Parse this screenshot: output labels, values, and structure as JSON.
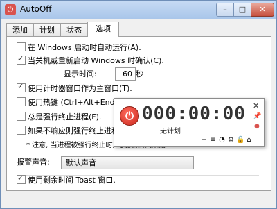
{
  "window": {
    "title": "AutoOff",
    "minimize": "–",
    "maximize": "□",
    "close": "✕"
  },
  "tabs": [
    {
      "label": "添加"
    },
    {
      "label": "计划"
    },
    {
      "label": "状态"
    },
    {
      "label": "选项"
    }
  ],
  "options": {
    "autostart": {
      "label": "在 Windows 启动时自动运行(A).",
      "checked": false
    },
    "confirm_shutdown": {
      "label": "当关机或重新启动 Windows 时确认(C).",
      "checked": true
    },
    "display_time_label": "显示时间:",
    "display_time_value": "60",
    "display_time_unit": "秒",
    "timer_main_window": {
      "label": "使用计时器窗口作为主窗口(T).",
      "checked": true
    },
    "hotkey": {
      "label": "使用热键 (Ctrl+Alt+End) 打开",
      "checked": false
    },
    "always_force": {
      "label": "总是强行终止进程(F).",
      "checked": false
    },
    "force_if_not_responding": {
      "label": "如果不响应则强行终止进程",
      "checked": false
    },
    "note": "* 注意, 当进程被强行终止时, 可能会丢失数据.",
    "alarm_label": "报警声音:",
    "alarm_value": "默认声音",
    "toast": {
      "label": "使用剩余时间 Toast 窗口.",
      "checked": true
    }
  },
  "timer_popup": {
    "time": "000:00:00",
    "status": "无计划",
    "close_icon": "close-icon",
    "pin_icon": "pin-icon",
    "tools": [
      "add-icon",
      "list-icon",
      "clock-icon",
      "gear-icon",
      "lock-icon",
      "home-icon"
    ]
  }
}
